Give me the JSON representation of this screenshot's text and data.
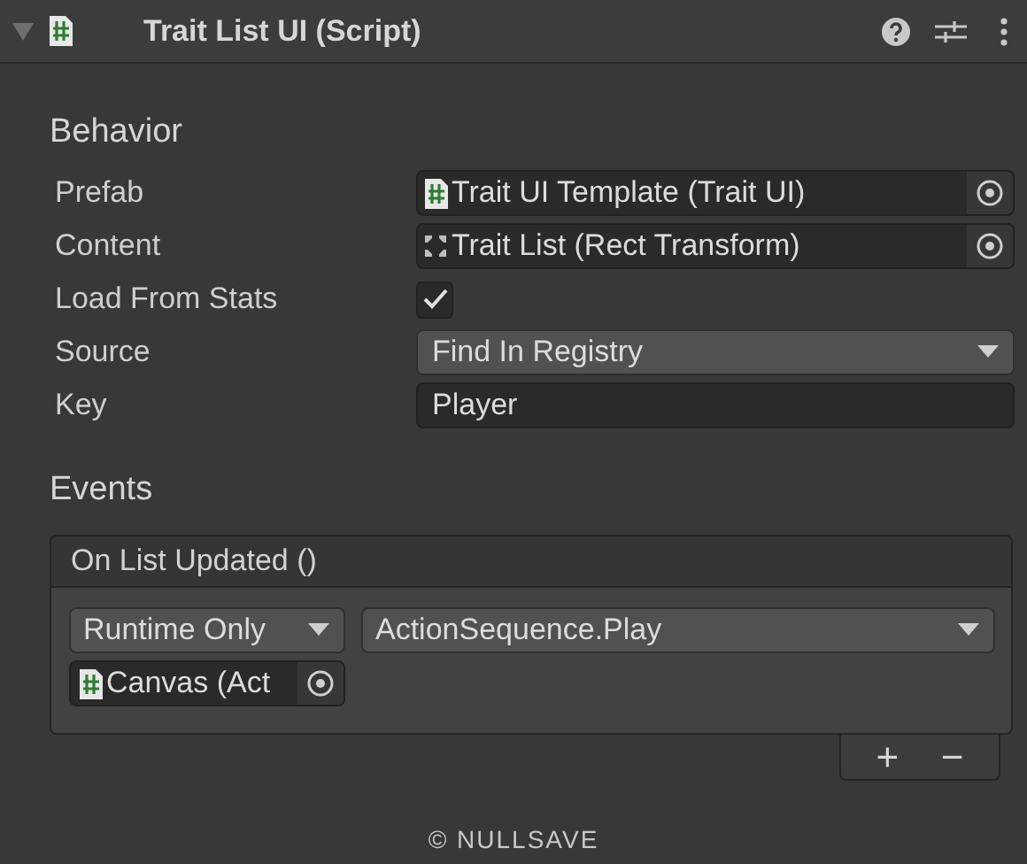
{
  "component": {
    "title": "Trait List UI (Script)",
    "expanded": true
  },
  "sections": [
    {
      "heading": "Behavior",
      "fields": [
        {
          "label": "Prefab",
          "kind": "script",
          "value": "Trait UI Template (Trait UI)"
        },
        {
          "label": "Content",
          "kind": "transform",
          "value": "Trait List (Rect Transform)"
        },
        {
          "label": "Load From Stats",
          "kind": "checkbox",
          "checked": true
        },
        {
          "label": "Source",
          "kind": "dropdown",
          "value": "Find In Registry"
        },
        {
          "label": "Key",
          "kind": "text",
          "value": "Player"
        }
      ]
    }
  ],
  "events": {
    "heading": "Events",
    "title": "On List Updated ()",
    "listeners": [
      {
        "mode": "Runtime Only",
        "function": "ActionSequence.Play",
        "target": "Canvas (Act"
      }
    ],
    "add": "+",
    "remove": "−"
  },
  "footer": "© NULLSAVE"
}
